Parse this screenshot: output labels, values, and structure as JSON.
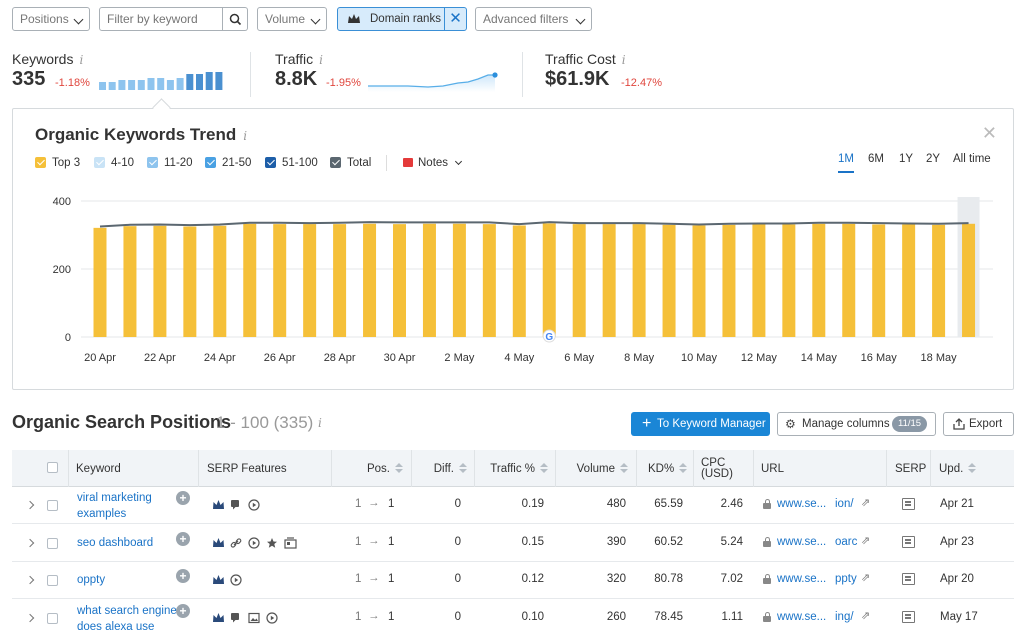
{
  "filters": {
    "positions_label": "Positions",
    "keyword_placeholder": "Filter by keyword",
    "volume_label": "Volume",
    "domain_ranks_label": "Domain ranks",
    "advanced_label": "Advanced filters"
  },
  "stats": {
    "keywords": {
      "label": "Keywords",
      "value": "335",
      "delta": "-1.18%",
      "sparkbars": [
        4,
        4,
        5,
        5,
        5,
        6,
        6,
        5,
        6,
        8,
        8,
        9,
        9
      ]
    },
    "traffic": {
      "label": "Traffic",
      "value": "8.8K",
      "delta": "-1.95%"
    },
    "traffic_cost": {
      "label": "Traffic Cost",
      "value": "$61.9K",
      "delta": "-12.47%"
    }
  },
  "trend": {
    "title": "Organic Keywords Trend",
    "legend": [
      {
        "label": "Top 3",
        "color": "#f5c039"
      },
      {
        "label": "4-10",
        "color": "#c9e3f6"
      },
      {
        "label": "11-20",
        "color": "#8ec4ee"
      },
      {
        "label": "21-50",
        "color": "#4aa1e3"
      },
      {
        "label": "51-100",
        "color": "#1d5ea8"
      },
      {
        "label": "Total",
        "color": "#5b6770"
      }
    ],
    "notes_label": "Notes",
    "ranges": [
      "1M",
      "6M",
      "1Y",
      "2Y",
      "All time"
    ],
    "active_range": "1M"
  },
  "chart_data": {
    "type": "bar",
    "x": [
      "20 Apr",
      "21 Apr",
      "22 Apr",
      "23 Apr",
      "24 Apr",
      "25 Apr",
      "26 Apr",
      "27 Apr",
      "28 Apr",
      "29 Apr",
      "30 Apr",
      "1 May",
      "2 May",
      "3 May",
      "4 May",
      "5 May",
      "6 May",
      "7 May",
      "8 May",
      "9 May",
      "10 May",
      "11 May",
      "12 May",
      "13 May",
      "14 May",
      "15 May",
      "16 May",
      "17 May",
      "18 May",
      "19 May"
    ],
    "tick_labels": [
      "20 Apr",
      "22 Apr",
      "24 Apr",
      "26 Apr",
      "28 Apr",
      "30 Apr",
      "2 May",
      "4 May",
      "6 May",
      "8 May",
      "10 May",
      "12 May",
      "14 May",
      "16 May",
      "18 May"
    ],
    "series": [
      {
        "name": "Top 3",
        "type": "bar",
        "color": "#f5c039",
        "values": [
          321,
          326,
          327,
          325,
          327,
          333,
          332,
          332,
          332,
          333,
          332,
          333,
          333,
          332,
          328,
          334,
          332,
          332,
          332,
          330,
          328,
          330,
          331,
          331,
          333,
          333,
          331,
          331,
          330,
          333
        ]
      },
      {
        "name": "Total",
        "type": "line",
        "color": "#5b6770",
        "values": [
          325,
          330,
          331,
          329,
          331,
          336,
          336,
          335,
          336,
          338,
          337,
          337,
          337,
          337,
          332,
          338,
          335,
          335,
          335,
          333,
          331,
          333,
          334,
          334,
          336,
          336,
          335,
          334,
          333,
          335
        ]
      }
    ],
    "ylim": [
      0,
      400
    ],
    "yticks": [
      0,
      200,
      400
    ],
    "grid": true,
    "annotation": "G"
  },
  "positions": {
    "title": "Organic Search Positions",
    "range_text": "1 - 100 (335)",
    "to_keyword_manager": "To Keyword Manager",
    "manage_columns": "Manage columns",
    "columns_badge": "11/15",
    "export": "Export",
    "headers": {
      "keyword": "Keyword",
      "serp_features": "SERP Features",
      "pos": "Pos.",
      "diff": "Diff.",
      "traffic_pct": "Traffic %",
      "volume": "Volume",
      "kd": "KD%",
      "cpc_line1": "CPC",
      "cpc_line2": "(USD)",
      "url": "URL",
      "serp": "SERP",
      "upd": "Upd."
    },
    "rows": [
      {
        "keyword": "viral marketing examples",
        "serp": [
          "crown-icon",
          "snippet-icon",
          "video-icon"
        ],
        "pos_from": "1",
        "pos_to": "1",
        "diff": "0",
        "traffic": "0.19",
        "volume": "480",
        "kd": "65.59",
        "cpc": "2.46",
        "url_start": "www.se...",
        "url_end": "ion/",
        "upd": "Apr 21"
      },
      {
        "keyword": "seo dashboard",
        "serp": [
          "crown-icon",
          "link-icon",
          "video-icon",
          "star-icon",
          "news-icon"
        ],
        "pos_from": "1",
        "pos_to": "1",
        "diff": "0",
        "traffic": "0.15",
        "volume": "390",
        "kd": "60.52",
        "cpc": "5.24",
        "url_start": "www.se...",
        "url_end": "oarc",
        "upd": "Apr 23"
      },
      {
        "keyword": "oppty",
        "serp": [
          "crown-icon",
          "video-icon"
        ],
        "pos_from": "1",
        "pos_to": "1",
        "diff": "0",
        "traffic": "0.12",
        "volume": "320",
        "kd": "80.78",
        "cpc": "7.02",
        "url_start": "www.se...",
        "url_end": "ppty",
        "upd": "Apr 20"
      },
      {
        "keyword": "what search engine does alexa use",
        "serp": [
          "crown-icon",
          "snippet-icon",
          "image-icon",
          "video-icon"
        ],
        "pos_from": "1",
        "pos_to": "1",
        "diff": "0",
        "traffic": "0.10",
        "volume": "260",
        "kd": "78.45",
        "cpc": "1.11",
        "url_start": "www.se...",
        "url_end": "ing/",
        "upd": "May 17"
      }
    ]
  }
}
